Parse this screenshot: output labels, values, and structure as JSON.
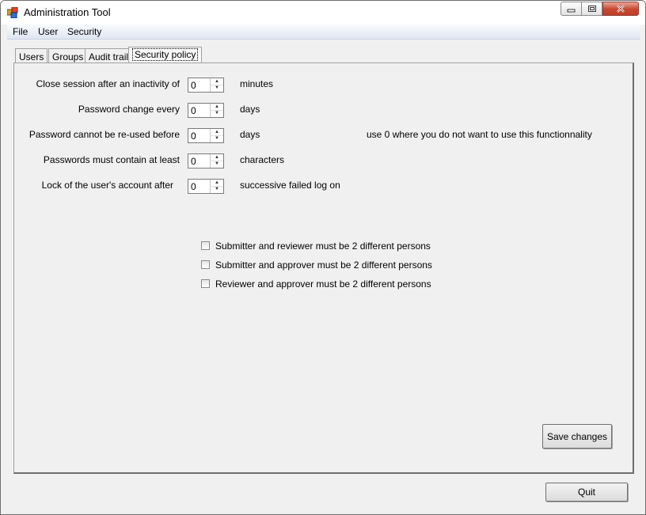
{
  "window": {
    "title": "Administration Tool"
  },
  "menu": [
    "File",
    "User",
    "Security"
  ],
  "tabs": [
    "Users",
    "Groups",
    "Audit trail",
    "Security policy"
  ],
  "active_tab": "Security policy",
  "policy": {
    "rows": [
      {
        "label": "Close session after an inactivity of",
        "value": "0",
        "unit": "minutes"
      },
      {
        "label": "Password change every",
        "value": "0",
        "unit": "days"
      },
      {
        "label": "Password cannot be re-used before",
        "value": "0",
        "unit": "days"
      },
      {
        "label": "Passwords must contain at least",
        "value": "0",
        "unit": "characters"
      },
      {
        "label": "Lock of the user's account after",
        "value": "0",
        "unit": "successive failed log on"
      }
    ],
    "hint": "use 0 where you do not want to use this functionnality",
    "checkboxes": [
      {
        "label": "Submitter and reviewer must be 2 different persons",
        "checked": false
      },
      {
        "label": "Submitter and approver must be 2 different persons",
        "checked": false
      },
      {
        "label": "Reviewer and approver must be 2 different persons",
        "checked": false
      }
    ],
    "save_label": "Save changes"
  },
  "quit_label": "Quit",
  "icons": {
    "app": "app-icon",
    "minimize": "minimize-icon",
    "maximize": "maximize-icon",
    "close": "close-icon",
    "spin_up": "spin-up-icon",
    "spin_down": "spin-down-icon"
  }
}
